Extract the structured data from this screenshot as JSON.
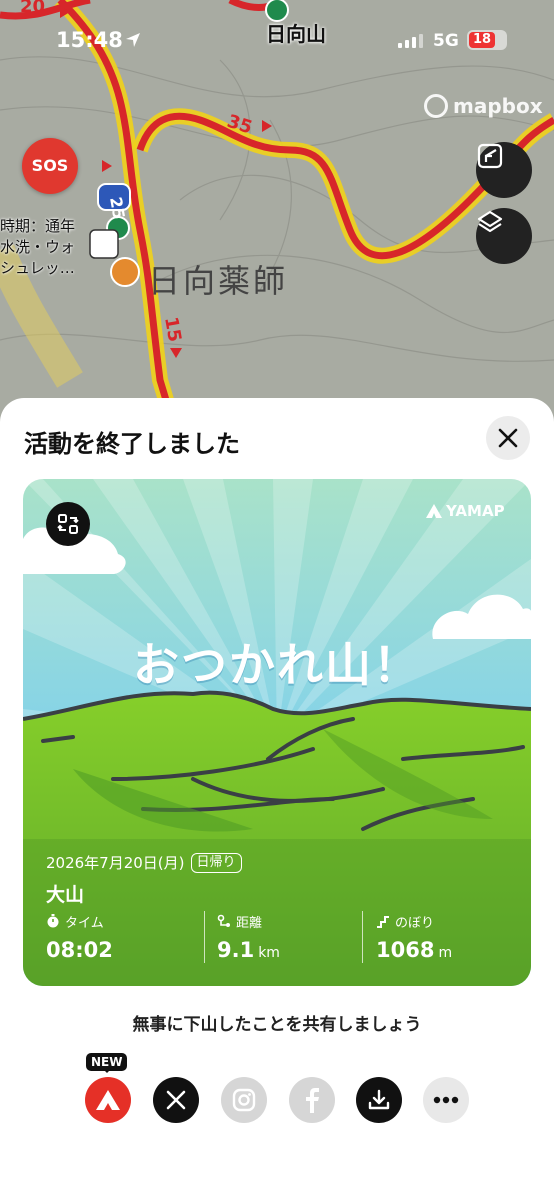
{
  "status": {
    "time": "15:48",
    "network": "5G",
    "battery": "18"
  },
  "map": {
    "peak_name": "日向山",
    "place_name": "日向薬師",
    "pin_label_lines": [
      "時期：通年",
      "水洗・ウォ",
      "シュレッ…"
    ],
    "sos_label": "SOS",
    "attribution": "mapbox",
    "route_markers": [
      "20",
      "35",
      "25",
      "15"
    ]
  },
  "sheet": {
    "title": "活動を終了しました",
    "card": {
      "brand": "YAMAP",
      "headline": "おつかれ山！",
      "date": "2026年7月20日(月)",
      "trip_type": "日帰り",
      "mountain": "大山",
      "stats": [
        {
          "label": "タイム",
          "value": "08:02",
          "unit": ""
        },
        {
          "label": "距離",
          "value": "9.1",
          "unit": "km"
        },
        {
          "label": "のぼり",
          "value": "1068",
          "unit": "m"
        }
      ]
    },
    "share_prompt": "無事に下山したことを共有しましょう",
    "new_badge": "NEW",
    "share_targets": [
      "yamap-icon",
      "x-icon",
      "instagram-icon",
      "facebook-icon",
      "download-icon",
      "more-icon"
    ]
  },
  "colors": {
    "route": "#d7262a",
    "sos": "#e0382f",
    "sky": "#6cc8ef",
    "grass": "#6fbf2a"
  }
}
